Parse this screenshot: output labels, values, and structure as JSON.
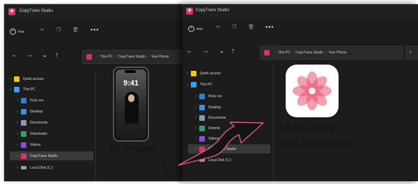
{
  "window_back": {
    "title": "CopyTrans Studio",
    "new_label": "New",
    "more_label": "•••",
    "address": [
      "This PC",
      "CopyTrans Studio",
      "Your Phone"
    ],
    "sidebar": [
      {
        "label": "Quick access",
        "icon": "star-icon"
      },
      {
        "label": "This PC",
        "icon": "computer-icon"
      },
      {
        "label": "Pictu    res",
        "icon": "pictures-icon"
      },
      {
        "label": "Desktop",
        "icon": "desktop-icon"
      },
      {
        "label": "Documents",
        "icon": "documents-icon"
      },
      {
        "label": "Downloads",
        "icon": "download-icon"
      },
      {
        "label": "Videos",
        "icon": "videos-icon"
      },
      {
        "label": "CopyTrans Studio",
        "icon": "copytrans-icon"
      },
      {
        "label": "Local Disk (C:)",
        "icon": "disk-icon"
      }
    ]
  },
  "window_front": {
    "title": "CopyTrans Studio",
    "new_label": "New",
    "more_label": "•••",
    "address": [
      "This PC",
      "CopyTrans Studio",
      "Your Phone"
    ],
    "sidebar": [
      {
        "label": "Quick access",
        "icon": "star-icon"
      },
      {
        "label": "This PC",
        "icon": "computer-icon"
      },
      {
        "label": "Pictu    res",
        "icon": "pictures-icon"
      },
      {
        "label": "Desktop",
        "icon": "desktop-icon"
      },
      {
        "label": "Documents",
        "icon": "documents-icon"
      },
      {
        "label": "Downlo",
        "icon": "download-icon"
      },
      {
        "label": "Videos",
        "icon": "videos-icon"
      },
      {
        "label": "CopyTrans Studio",
        "icon": "copytrans-icon"
      },
      {
        "label": "Local Disk (C:)",
        "icon": "disk-icon"
      }
    ]
  },
  "phone": {
    "time": "9:41",
    "caption": "Ihr iPhone"
  },
  "photos": {
    "caption_line1": "Photo library",
    "caption_line2": "(Foto-Mediathek)"
  },
  "colors": {
    "accent": "#d6336c",
    "arrow": "#e05a86",
    "window_bg": "#1c1c1c",
    "selected_row": "#3a3a3a"
  }
}
